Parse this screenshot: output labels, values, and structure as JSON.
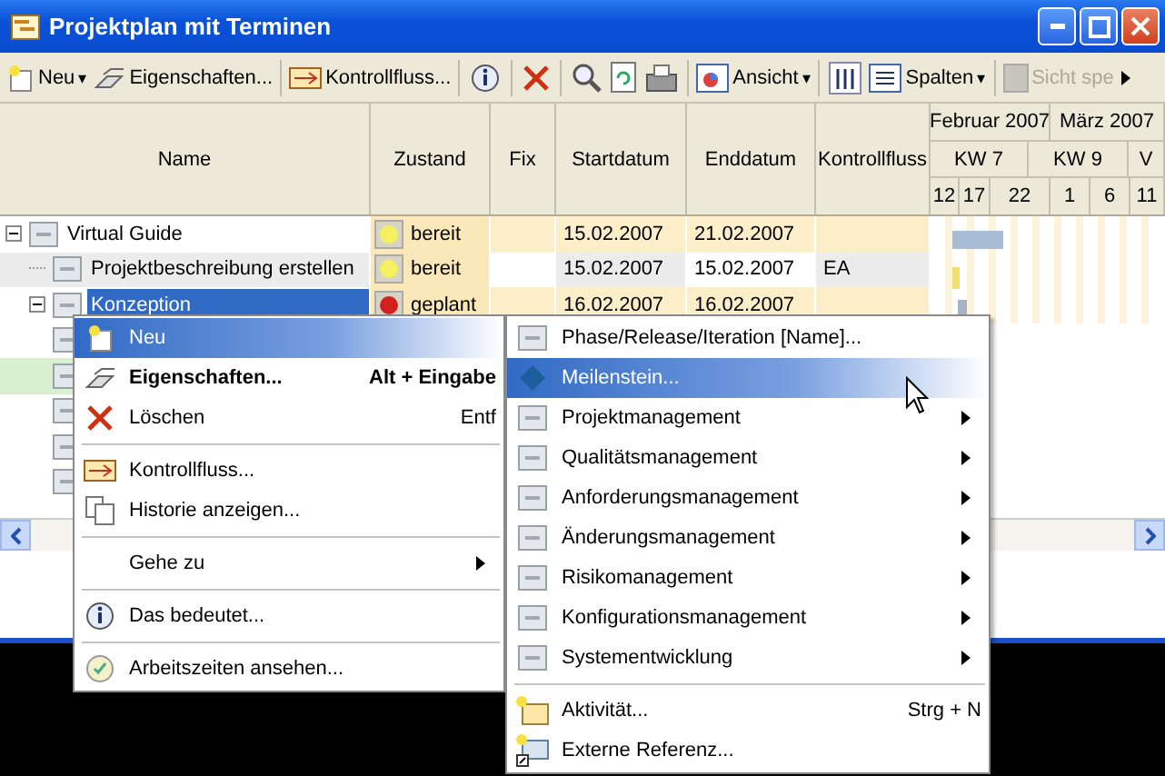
{
  "window": {
    "title": "Projektplan mit Terminen"
  },
  "toolbar": [
    {
      "label": "Neu",
      "caret": "▾",
      "disabled": false
    },
    {
      "label": "Eigenschaften...",
      "disabled": false
    },
    {
      "label": "Kontrollfluss...",
      "disabled": false
    },
    {
      "label": "Ansicht",
      "caret": "▾",
      "disabled": false
    },
    {
      "label": "Spalten",
      "caret": "▾",
      "disabled": false
    },
    {
      "label": "Sicht spe",
      "disabled": true
    }
  ],
  "table": {
    "columns": [
      "Name",
      "Zustand",
      "Fix",
      "Startdatum",
      "Enddatum",
      "Kontrollfluss"
    ],
    "months": [
      "Februar 2007",
      "März 2007"
    ],
    "weeks": [
      "KW 7",
      "KW 9",
      "V"
    ],
    "days": [
      "12",
      "17",
      "22",
      "1",
      "6",
      "11"
    ],
    "rows": [
      {
        "name": "Virtual Guide",
        "state": "bereit",
        "color": "#f4f060",
        "start": "15.02.2007",
        "end": "21.02.2007",
        "expanded": true,
        "selected": false,
        "children": [
          {
            "name": "Projektbeschreibung erstellen",
            "state": "bereit",
            "color": "#f4f060",
            "start": "15.02.2007",
            "end": "15.02.2007",
            "control_flow": "EA",
            "selected": false
          },
          {
            "name": "Konzeption",
            "state": "geplant",
            "color": "#d02020",
            "start": "16.02.2007",
            "end": "16.02.2007",
            "expanded": true,
            "selected": true
          }
        ]
      }
    ]
  },
  "context_menu": [
    {
      "kind": "item",
      "label": "Neu",
      "submenu": false,
      "selected": true,
      "default": false
    },
    {
      "kind": "item",
      "label": "Eigenschaften...",
      "shortcut": "Alt + Eingabe",
      "submenu": false,
      "selected": false,
      "default": true
    },
    {
      "kind": "item",
      "label": "Löschen",
      "shortcut": "Entf",
      "submenu": false,
      "selected": false,
      "default": false
    },
    {
      "kind": "separator"
    },
    {
      "kind": "item",
      "label": "Kontrollfluss...",
      "submenu": false,
      "selected": false,
      "default": false
    },
    {
      "kind": "item",
      "label": "Historie anzeigen...",
      "submenu": false,
      "selected": false,
      "default": false
    },
    {
      "kind": "separator"
    },
    {
      "kind": "item",
      "label": "Gehe zu",
      "submenu": true,
      "selected": false,
      "default": false
    },
    {
      "kind": "separator"
    },
    {
      "kind": "item",
      "label": "Das bedeutet...",
      "submenu": false,
      "selected": false,
      "default": false
    },
    {
      "kind": "separator"
    },
    {
      "kind": "item",
      "label": "Arbeitszeiten ansehen...",
      "submenu": false,
      "selected": false,
      "default": false
    }
  ],
  "submenu": [
    {
      "kind": "item",
      "label": "Phase/Release/Iteration [Name]...",
      "submenu": false,
      "selected": false
    },
    {
      "kind": "item",
      "label": "Meilenstein...",
      "submenu": false,
      "selected": true
    },
    {
      "kind": "item",
      "label": "Projektmanagement",
      "submenu": true,
      "selected": false
    },
    {
      "kind": "item",
      "label": "Qualitätsmanagement",
      "submenu": true,
      "selected": false
    },
    {
      "kind": "item",
      "label": "Anforderungsmanagement",
      "submenu": true,
      "selected": false
    },
    {
      "kind": "item",
      "label": "Änderungsmanagement",
      "submenu": true,
      "selected": false
    },
    {
      "kind": "item",
      "label": "Risikomanagement",
      "submenu": true,
      "selected": false
    },
    {
      "kind": "item",
      "label": "Konfigurationsmanagement",
      "submenu": true,
      "selected": false
    },
    {
      "kind": "item",
      "label": "Systementwicklung",
      "submenu": true,
      "selected": false
    },
    {
      "kind": "separator"
    },
    {
      "kind": "item",
      "label": "Aktivität...",
      "shortcut": "Strg + N",
      "submenu": false,
      "selected": false
    },
    {
      "kind": "item",
      "label": "Externe Referenz...",
      "submenu": false,
      "selected": false
    }
  ]
}
